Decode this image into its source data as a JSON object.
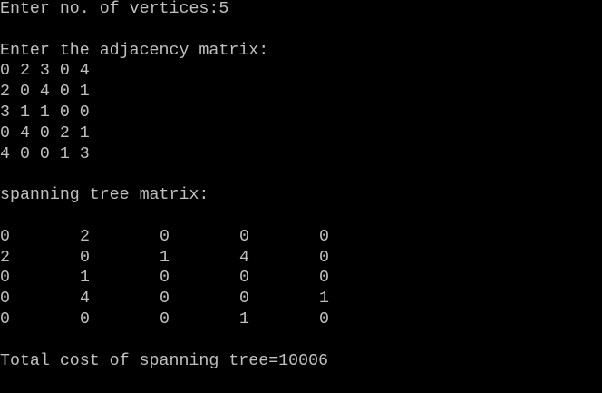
{
  "colors": {
    "background": "#000000",
    "text": "#c0c0c0"
  },
  "prompt_vertices": "Enter no. of vertices:5",
  "prompt_matrix": "Enter the adjacency matrix:",
  "adjacency_input": [
    "0 2 3 0 4",
    "2 0 4 0 1",
    "3 1 1 0 0",
    "0 4 0 2 1",
    "4 0 0 1 3"
  ],
  "spanning_heading": "spanning tree matrix:",
  "spanning_matrix": [
    [
      "0",
      "2",
      "0",
      "0",
      "0"
    ],
    [
      "2",
      "0",
      "1",
      "4",
      "0"
    ],
    [
      "0",
      "1",
      "0",
      "0",
      "0"
    ],
    [
      "0",
      "4",
      "0",
      "0",
      "1"
    ],
    [
      "0",
      "0",
      "0",
      "1",
      "0"
    ]
  ],
  "total_cost": "Total cost of spanning tree=10006"
}
